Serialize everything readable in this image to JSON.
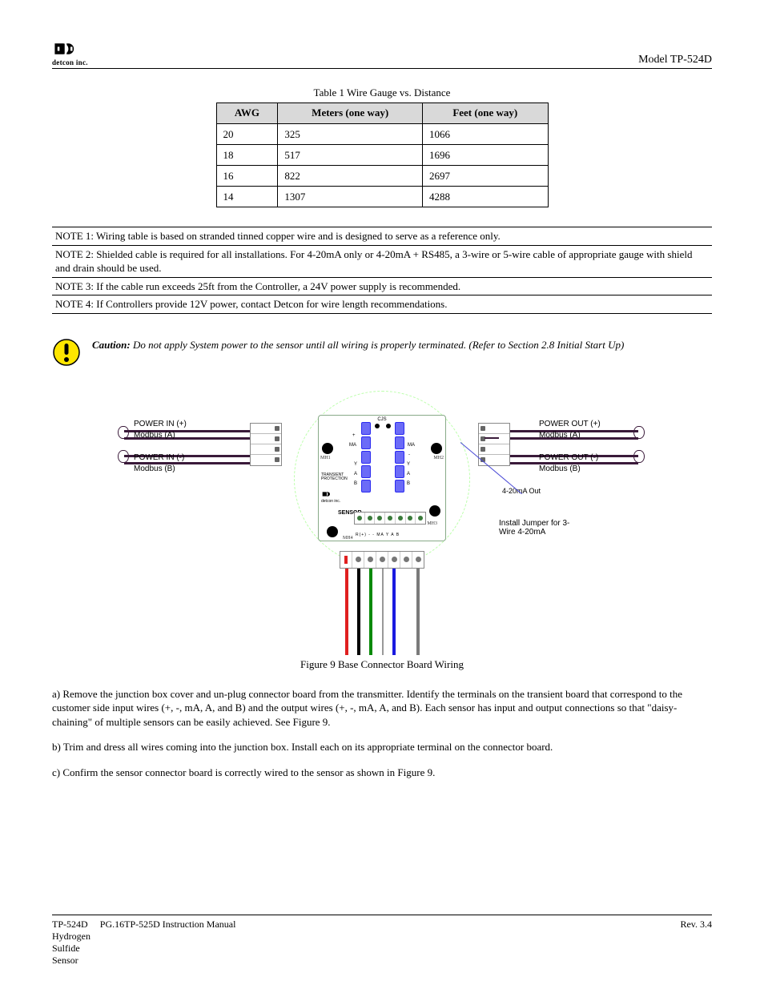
{
  "header": {
    "logo_brand": "detcon inc.",
    "model": "Model TP-524D"
  },
  "table": {
    "title": "Table 1 Wire Gauge vs. Distance",
    "headers": [
      "AWG",
      "Meters (one way)",
      "Feet (one way)"
    ],
    "rows": [
      [
        "20",
        "325",
        "1066"
      ],
      [
        "18",
        "517",
        "1696"
      ],
      [
        "16",
        "822",
        "2697"
      ],
      [
        "14",
        "1307",
        "4288"
      ]
    ]
  },
  "notes": [
    "NOTE 1: Wiring table is based on stranded tinned copper wire and is designed to serve as a reference only.",
    "NOTE 2: Shielded cable is required for all installations. For 4-20mA only or 4-20mA + RS485, a 3-wire or 5-wire cable of appropriate gauge with shield and drain should be used.",
    "NOTE 3: If the cable run exceeds 25ft from the Controller, a 24V power supply is recommended.",
    "NOTE 4: If Controllers provide 12V power, contact Detcon for wire length recommendations."
  ],
  "caution": {
    "label": "Caution: ",
    "body": "Do not apply System power to the sensor until all wiring is properly terminated. (Refer to Section 2.8 Initial Start Up)"
  },
  "figure": {
    "side_labels": {
      "left_top": [
        "POWER IN (+)",
        "Modbus (A)"
      ],
      "left_bottom": [
        "POWER IN (-)",
        "Modbus (B)"
      ],
      "right_top": [
        "POWER OUT (+)",
        "Modbus (A)"
      ],
      "right_bottom": [
        "POWER OUT (-)",
        "Modbus (B)"
      ],
      "mA_out": "4-20mA Out",
      "callout": "Install Jumper for 3-Wire 4-20mA"
    },
    "pcb": {
      "mh1": "MH1",
      "mh2": "MH2",
      "mh3": "MH3",
      "mh4": "MH4",
      "top_label": "CJS",
      "side_labels_left": [
        "-",
        "MA",
        "Y",
        "A",
        "B"
      ],
      "side_labels_right": [
        "+",
        "MA",
        "-",
        "Y",
        "A",
        "B"
      ],
      "transient": "TRANSIENT PROTECTION",
      "detcon_text": "detcon inc.",
      "sensor_label": "SENSOR",
      "sensor_pins": "R(+)  -  -  MA  Y  A  B"
    },
    "caption": "Figure 9 Base Connector Board Wiring"
  },
  "body_paragraphs": [
    "a)  Remove the junction box cover and un-plug connector board from the transmitter. Identify the terminals on the transient board that correspond to the customer side input wires (+, -, mA, A, and B) and the output wires (+, -, mA, A, and B).  Each sensor has input and output connections so that \"daisy-chaining\" of multiple sensors can be easily achieved. See Figure 9.",
    "b)  Trim and dress all wires coming into the junction box.  Install each on its appropriate terminal on the connector board.",
    "c)  Confirm the sensor connector board is correctly wired to the sensor as shown in Figure 9."
  ],
  "footer": {
    "left": "TP-524D Hydrogen Sulfide Sensor",
    "center": "PG.16",
    "right": "TP-525D Instruction Manual                                                                                                                                                                                         Rev. 3.4"
  }
}
